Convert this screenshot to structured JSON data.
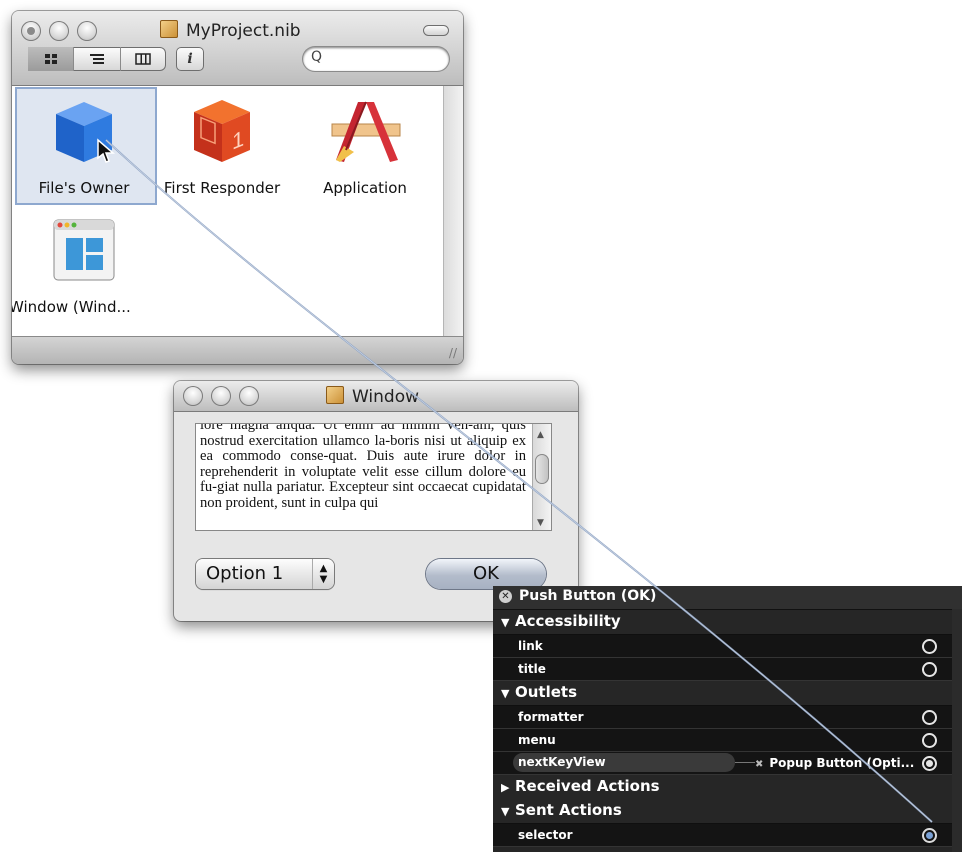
{
  "nib_window": {
    "title": "MyProject.nib",
    "view_modes": [
      "icon-view",
      "list-view",
      "column-view"
    ],
    "info_label": "i",
    "search_placeholder": "Q",
    "items": [
      {
        "label": "File's Owner",
        "icon": "blue-cube-icon",
        "selected": true
      },
      {
        "label": "First Responder",
        "icon": "red-cube-icon",
        "selected": false
      },
      {
        "label": "Application",
        "icon": "application-icon",
        "selected": false
      },
      {
        "label": "Window (Wind...",
        "icon": "window-icon",
        "selected": false
      }
    ]
  },
  "window": {
    "title": "Window",
    "text": "lore magna aliqua. Ut enim ad minim ven-am, quis nostrud exercitation ullamco la-boris nisi ut aliquip ex ea commodo conse-quat. Duis aute irure dolor in reprehenderit in voluptate velit esse cillum dolore eu fu-giat nulla pariatur. Excepteur sint occaecat cupidatat non proident, sunt in culpa qui",
    "popup_label": "Option 1",
    "ok_label": "OK"
  },
  "hud": {
    "title": "Push Button (OK)",
    "sections": [
      {
        "label": "Accessibility",
        "expanded": true,
        "items": [
          {
            "label": "link",
            "state": "empty"
          },
          {
            "label": "title",
            "state": "empty"
          }
        ]
      },
      {
        "label": "Outlets",
        "expanded": true,
        "items": [
          {
            "label": "formatter",
            "state": "empty"
          },
          {
            "label": "menu",
            "state": "empty"
          },
          {
            "label": "nextKeyView",
            "state": "connected",
            "connection": "Popup Button (Opti..."
          }
        ]
      },
      {
        "label": "Received Actions",
        "expanded": false,
        "items": []
      },
      {
        "label": "Sent Actions",
        "expanded": true,
        "items": [
          {
            "label": "selector",
            "state": "active"
          }
        ]
      }
    ]
  },
  "colors": {
    "selection_fill": "#dfe6f1",
    "selection_border": "#8ea8cf",
    "connection_line": "#8ea3c4",
    "hud_background": "#161616"
  }
}
